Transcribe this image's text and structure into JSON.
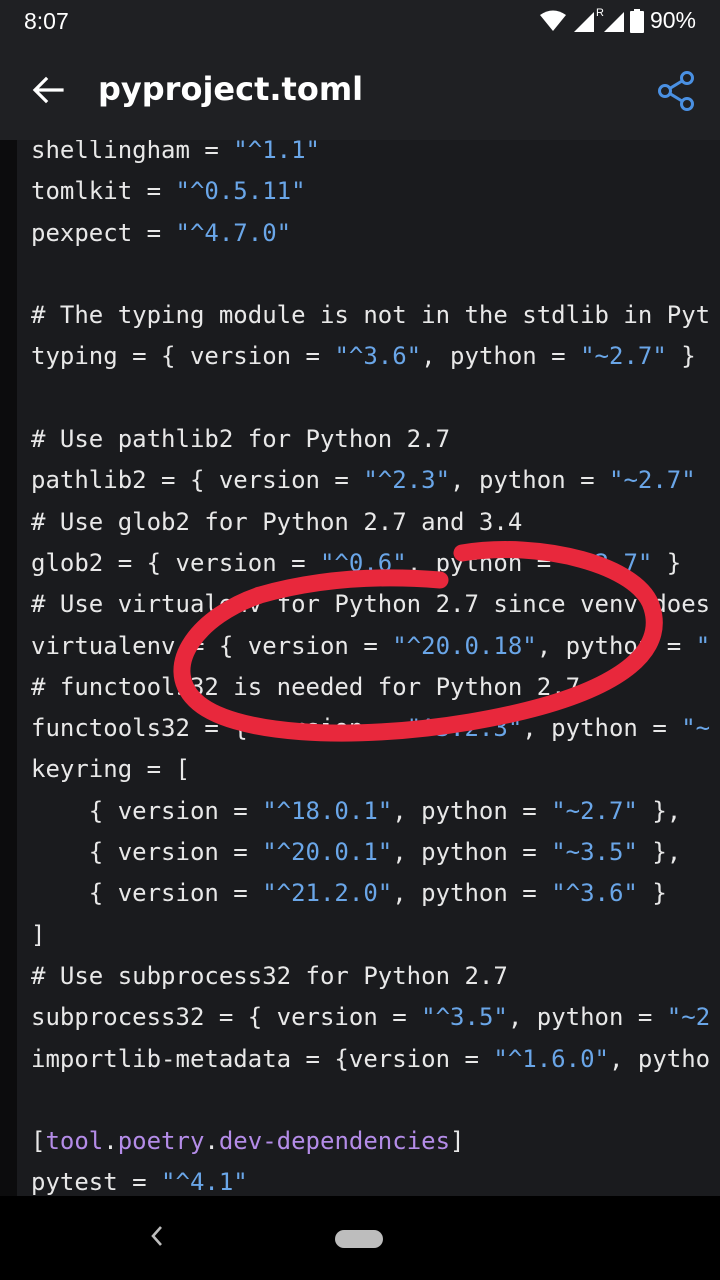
{
  "status_bar": {
    "time": "8:07",
    "roaming_indicator": "R",
    "battery": "90%"
  },
  "app_bar": {
    "title": "pyproject.toml"
  },
  "code_lines": [
    [
      {
        "t": "shellingham = ",
        "c": "c"
      },
      {
        "t": "\"^1.1\"",
        "c": "s"
      }
    ],
    [
      {
        "t": "tomlkit = ",
        "c": "c"
      },
      {
        "t": "\"^0.5.11\"",
        "c": "s"
      }
    ],
    [
      {
        "t": "pexpect = ",
        "c": "c"
      },
      {
        "t": "\"^4.7.0\"",
        "c": "s"
      }
    ],
    [],
    [
      {
        "t": "# The typing module is not in the stdlib in Pyt",
        "c": "c"
      }
    ],
    [
      {
        "t": "typing = { version = ",
        "c": "c"
      },
      {
        "t": "\"^3.6\"",
        "c": "s"
      },
      {
        "t": ", python = ",
        "c": "c"
      },
      {
        "t": "\"~2.7\"",
        "c": "s"
      },
      {
        "t": " }",
        "c": "c"
      }
    ],
    [],
    [
      {
        "t": "# Use pathlib2 for Python 2.7",
        "c": "c"
      }
    ],
    [
      {
        "t": "pathlib2 = { version = ",
        "c": "c"
      },
      {
        "t": "\"^2.3\"",
        "c": "s"
      },
      {
        "t": ", python = ",
        "c": "c"
      },
      {
        "t": "\"~2.7\"",
        "c": "s"
      }
    ],
    [
      {
        "t": "# Use glob2 for Python 2.7 and 3.4",
        "c": "c"
      }
    ],
    [
      {
        "t": "glob2 = { version = ",
        "c": "c"
      },
      {
        "t": "\"^0.6\"",
        "c": "s"
      },
      {
        "t": ", python = ",
        "c": "c"
      },
      {
        "t": "\"~2.7\"",
        "c": "s"
      },
      {
        "t": " }",
        "c": "c"
      }
    ],
    [
      {
        "t": "# Use virtualenv for Python 2.7 since venv does",
        "c": "c"
      }
    ],
    [
      {
        "t": "virtualenv = { version = ",
        "c": "c"
      },
      {
        "t": "\"^20.0.18\"",
        "c": "s"
      },
      {
        "t": ", python = ",
        "c": "c"
      },
      {
        "t": "\"",
        "c": "s"
      }
    ],
    [
      {
        "t": "# functools32 is needed for Python 2.7",
        "c": "c"
      }
    ],
    [
      {
        "t": "functools32 = { version = ",
        "c": "c"
      },
      {
        "t": "\"^3.2.3\"",
        "c": "s"
      },
      {
        "t": ", python = ",
        "c": "c"
      },
      {
        "t": "\"~",
        "c": "s"
      }
    ],
    [
      {
        "t": "keyring = [",
        "c": "c"
      }
    ],
    [
      {
        "t": "    { version = ",
        "c": "c"
      },
      {
        "t": "\"^18.0.1\"",
        "c": "s"
      },
      {
        "t": ", python = ",
        "c": "c"
      },
      {
        "t": "\"~2.7\"",
        "c": "s"
      },
      {
        "t": " },",
        "c": "c"
      }
    ],
    [
      {
        "t": "    { version = ",
        "c": "c"
      },
      {
        "t": "\"^20.0.1\"",
        "c": "s"
      },
      {
        "t": ", python = ",
        "c": "c"
      },
      {
        "t": "\"~3.5\"",
        "c": "s"
      },
      {
        "t": " },",
        "c": "c"
      }
    ],
    [
      {
        "t": "    { version = ",
        "c": "c"
      },
      {
        "t": "\"^21.2.0\"",
        "c": "s"
      },
      {
        "t": ", python = ",
        "c": "c"
      },
      {
        "t": "\"^3.6\"",
        "c": "s"
      },
      {
        "t": " }",
        "c": "c"
      }
    ],
    [
      {
        "t": "]",
        "c": "c"
      }
    ],
    [
      {
        "t": "# Use subprocess32 for Python 2.7",
        "c": "c"
      }
    ],
    [
      {
        "t": "subprocess32 = { version = ",
        "c": "c"
      },
      {
        "t": "\"^3.5\"",
        "c": "s"
      },
      {
        "t": ", python = ",
        "c": "c"
      },
      {
        "t": "\"~2",
        "c": "s"
      }
    ],
    [
      {
        "t": "importlib-metadata = {version = ",
        "c": "c"
      },
      {
        "t": "\"^1.6.0\"",
        "c": "s"
      },
      {
        "t": ", pytho",
        "c": "c"
      }
    ],
    [],
    [
      {
        "t": "[",
        "c": "c"
      },
      {
        "t": "tool",
        "c": "k"
      },
      {
        "t": ".",
        "c": "c"
      },
      {
        "t": "poetry",
        "c": "k"
      },
      {
        "t": ".",
        "c": "c"
      },
      {
        "t": "dev-dependencies",
        "c": "k"
      },
      {
        "t": "]",
        "c": "c"
      }
    ],
    [
      {
        "t": "pytest = ",
        "c": "c"
      },
      {
        "t": "\"^4.1\"",
        "c": "s"
      }
    ]
  ],
  "colors": {
    "background": "#1a1b1e",
    "string": "#6aa6e8",
    "table_key": "#b48ce8",
    "annotation": "#e8283c",
    "accent": "#4a90e2"
  },
  "icons": {
    "back": "arrow-left-icon",
    "share": "share-icon",
    "nav_back": "chevron-left-icon"
  }
}
